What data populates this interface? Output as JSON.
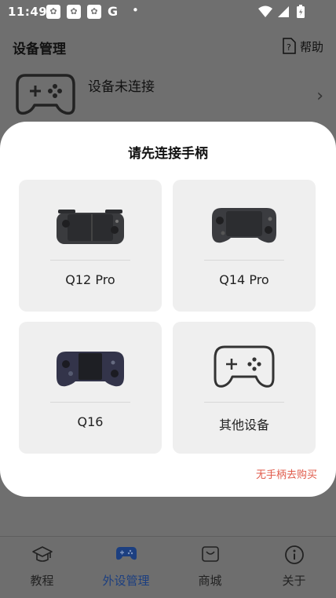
{
  "status_bar": {
    "time": "11:49",
    "notifications": [
      "baidu-icon",
      "baidu-icon",
      "baidu-icon"
    ],
    "g_label": "G",
    "dot": "•"
  },
  "header": {
    "title": "设备管理",
    "help_label": "帮助"
  },
  "device": {
    "status": "设备未连接"
  },
  "modal": {
    "title": "请先连接手柄",
    "devices": [
      {
        "label": "Q12 Pro"
      },
      {
        "label": "Q14 Pro"
      },
      {
        "label": "Q16"
      },
      {
        "label": "其他设备"
      }
    ],
    "buy_link": "无手柄去购买"
  },
  "bottom_nav": {
    "items": [
      {
        "label": "教程",
        "icon": "graduation-cap-icon"
      },
      {
        "label": "外设管理",
        "icon": "gamepad-icon"
      },
      {
        "label": "商城",
        "icon": "shop-bag-icon"
      },
      {
        "label": "关于",
        "icon": "info-icon"
      }
    ],
    "active_index": 1
  },
  "colors": {
    "accent": "#1c3f80",
    "link": "#e05a4a",
    "overlay": "#6f6f6f"
  }
}
